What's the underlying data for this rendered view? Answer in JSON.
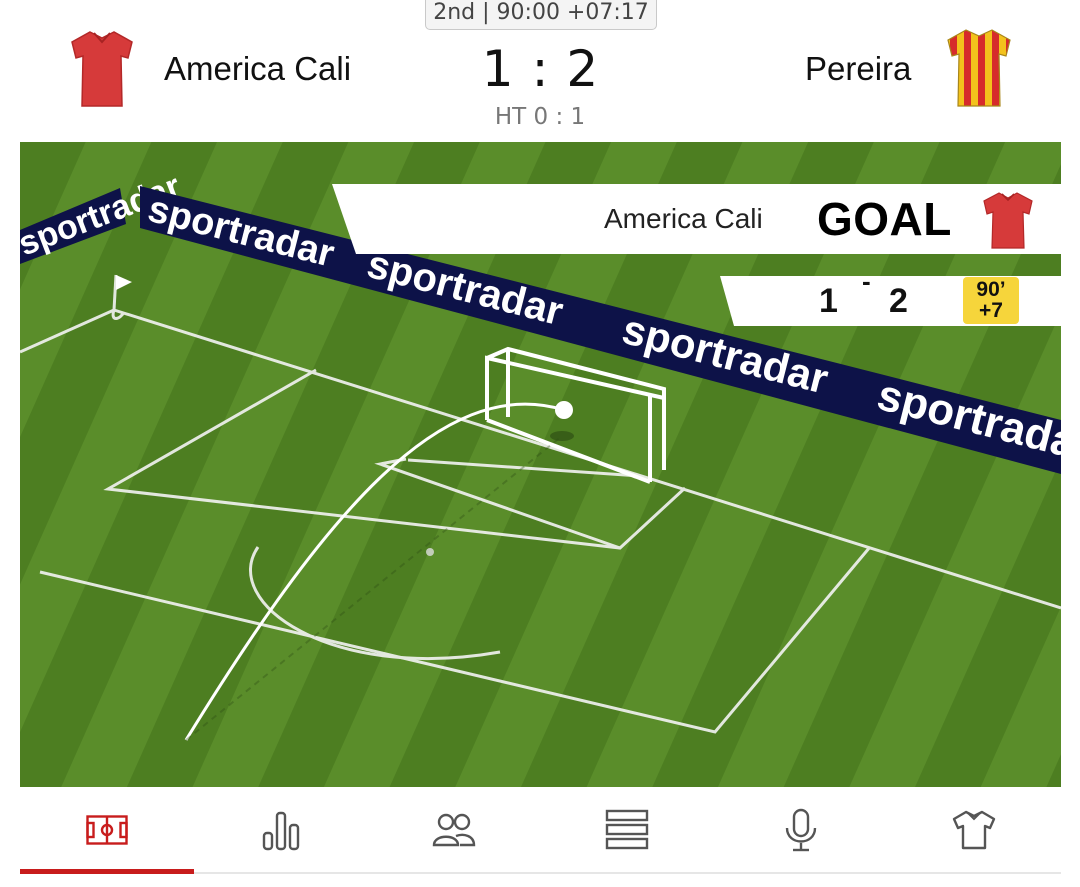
{
  "match": {
    "period_time": "2nd | 90:00 +07:17",
    "home_team": "America Cali",
    "away_team": "Pereira",
    "home_score": "1",
    "score_separator": ":",
    "away_score": "2",
    "halftime": "HT 0 : 1"
  },
  "event": {
    "team": "America Cali",
    "type": "GOAL",
    "home_score": "1",
    "separator": "-",
    "away_score": "2",
    "minute": "90’",
    "added": "+7"
  },
  "ad_board_text": "sportradar",
  "tabs": [
    {
      "name": "pitch",
      "icon": "pitch-icon",
      "active": true
    },
    {
      "name": "stats",
      "icon": "bar-chart-icon",
      "active": false
    },
    {
      "name": "lineups",
      "icon": "people-icon",
      "active": false
    },
    {
      "name": "timeline",
      "icon": "list-icon",
      "active": false
    },
    {
      "name": "commentary",
      "icon": "microphone-icon",
      "active": false
    },
    {
      "name": "kits",
      "icon": "shirt-icon",
      "active": false
    }
  ],
  "colors": {
    "accent": "#c81c1c",
    "pitch_light": "#5c8f2c",
    "pitch_dark": "#4e7f22",
    "ad_board": "#0d1248",
    "time_badge": "#f6d53b",
    "home_kit": "#d63a3a",
    "away_kit_red": "#d62b2b",
    "away_kit_yellow": "#f3c21c"
  }
}
